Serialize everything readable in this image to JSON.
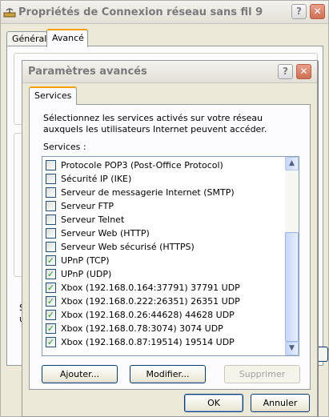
{
  "main_window": {
    "title": "Propriétés de Connexion réseau sans fil 9",
    "help_glyph": "?",
    "close_glyph": "✕",
    "tabs": [
      {
        "label": "Général",
        "active": false
      },
      {
        "label": "Avancé",
        "active": true
      }
    ],
    "fragments": [
      "S",
      "u"
    ]
  },
  "dialog": {
    "title": "Paramètres avancés",
    "help_glyph": "?",
    "close_glyph": "✕",
    "tab_label": "Services",
    "description": "Sélectionnez les services activés sur votre réseau auxquels les utilisateurs Internet peuvent accéder.",
    "list_label": "Services :",
    "services": [
      {
        "label": "Protocole POP3 (Post-Office Protocol)",
        "checked": false
      },
      {
        "label": "Sécurité IP (IKE)",
        "checked": false
      },
      {
        "label": "Serveur de messagerie Internet (SMTP)",
        "checked": false
      },
      {
        "label": "Serveur FTP",
        "checked": false
      },
      {
        "label": "Serveur Telnet",
        "checked": false
      },
      {
        "label": "Serveur Web (HTTP)",
        "checked": false
      },
      {
        "label": "Serveur Web sécurisé (HTTPS)",
        "checked": false
      },
      {
        "label": "UPnP (TCP)",
        "checked": true
      },
      {
        "label": "UPnP (UDP)",
        "checked": true
      },
      {
        "label": "Xbox (192.168.0.164:37791) 37791 UDP",
        "checked": true
      },
      {
        "label": "Xbox (192.168.0.222:26351) 26351 UDP",
        "checked": true
      },
      {
        "label": "Xbox (192.168.0.26:44628) 44628 UDP",
        "checked": true
      },
      {
        "label": "Xbox (192.168.0.78:3074) 3074 UDP",
        "checked": true
      },
      {
        "label": "Xbox (192.168.0.87:19514) 19514 UDP",
        "checked": true
      }
    ],
    "scroll_up_glyph": "▲",
    "scroll_down_glyph": "▼",
    "add_label": "Ajouter...",
    "edit_label": "Modifier...",
    "delete_label": "Supprimer",
    "ok_label": "OK",
    "cancel_label": "Annuler"
  }
}
